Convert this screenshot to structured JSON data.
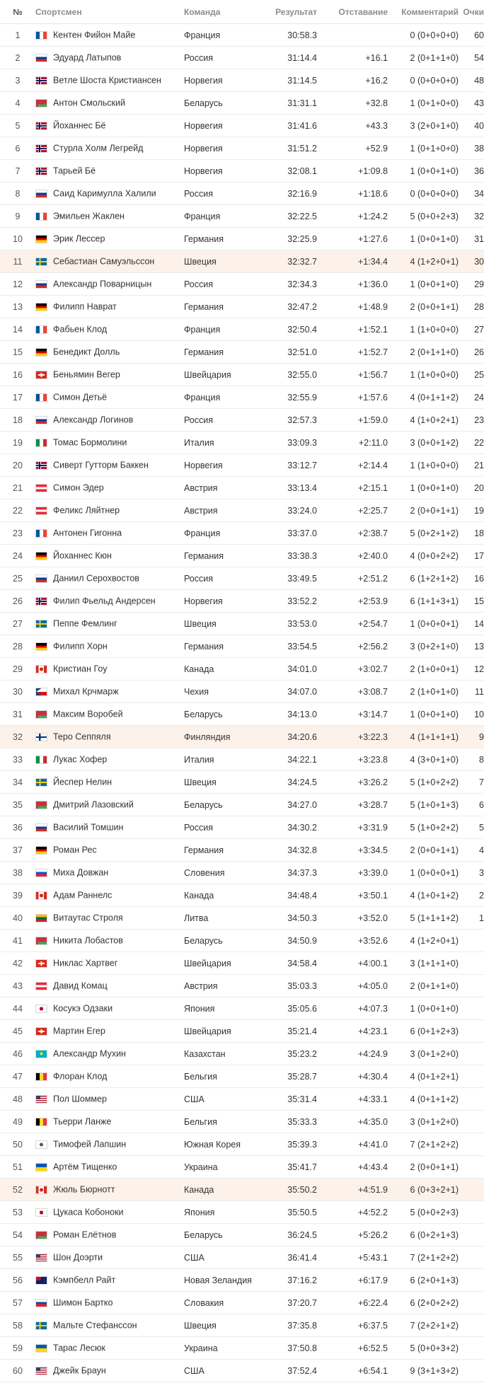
{
  "headers": {
    "num": "№",
    "athlete": "Спортсмен",
    "team": "Команда",
    "result": "Результат",
    "gap": "Отставание",
    "comment": "Комментарий",
    "points": "Очки"
  },
  "highlight_color": "#fdf2ea",
  "rows": [
    {
      "num": "1",
      "flag": "FR",
      "name": "Кентен Фийон Майе",
      "team": "Франция",
      "result": "30:58.3",
      "gap": "",
      "comment": "0 (0+0+0+0)",
      "points": "60"
    },
    {
      "num": "2",
      "flag": "RU",
      "name": "Эдуард Латыпов",
      "team": "Россия",
      "result": "31:14.4",
      "gap": "+16.1",
      "comment": "2 (0+1+1+0)",
      "points": "54"
    },
    {
      "num": "3",
      "flag": "NO",
      "name": "Ветле Шоста Кристиансен",
      "team": "Норвегия",
      "result": "31:14.5",
      "gap": "+16.2",
      "comment": "0 (0+0+0+0)",
      "points": "48"
    },
    {
      "num": "4",
      "flag": "BY",
      "name": "Антон Смольский",
      "team": "Беларусь",
      "result": "31:31.1",
      "gap": "+32.8",
      "comment": "1 (0+1+0+0)",
      "points": "43"
    },
    {
      "num": "5",
      "flag": "NO",
      "name": "Йоханнес Бё",
      "team": "Норвегия",
      "result": "31:41.6",
      "gap": "+43.3",
      "comment": "3 (2+0+1+0)",
      "points": "40"
    },
    {
      "num": "6",
      "flag": "NO",
      "name": "Стурла Холм Легрейд",
      "team": "Норвегия",
      "result": "31:51.2",
      "gap": "+52.9",
      "comment": "1 (0+1+0+0)",
      "points": "38"
    },
    {
      "num": "7",
      "flag": "NO",
      "name": "Тарьей Бё",
      "team": "Норвегия",
      "result": "32:08.1",
      "gap": "+1:09.8",
      "comment": "1 (0+0+1+0)",
      "points": "36"
    },
    {
      "num": "8",
      "flag": "RU",
      "name": "Саид Каримулла Халили",
      "team": "Россия",
      "result": "32:16.9",
      "gap": "+1:18.6",
      "comment": "0 (0+0+0+0)",
      "points": "34"
    },
    {
      "num": "9",
      "flag": "FR",
      "name": "Эмильен Жаклен",
      "team": "Франция",
      "result": "32:22.5",
      "gap": "+1:24.2",
      "comment": "5 (0+0+2+3)",
      "points": "32"
    },
    {
      "num": "10",
      "flag": "DE",
      "name": "Эрик Лессер",
      "team": "Германия",
      "result": "32:25.9",
      "gap": "+1:27.6",
      "comment": "1 (0+0+1+0)",
      "points": "31"
    },
    {
      "num": "11",
      "flag": "SE",
      "name": "Себастиан Самуэльссон",
      "team": "Швеция",
      "result": "32:32.7",
      "gap": "+1:34.4",
      "comment": "4 (1+2+0+1)",
      "points": "30",
      "hl": true
    },
    {
      "num": "12",
      "flag": "RU",
      "name": "Александр Поварницын",
      "team": "Россия",
      "result": "32:34.3",
      "gap": "+1:36.0",
      "comment": "1 (0+0+1+0)",
      "points": "29"
    },
    {
      "num": "13",
      "flag": "DE",
      "name": "Филипп Наврат",
      "team": "Германия",
      "result": "32:47.2",
      "gap": "+1:48.9",
      "comment": "2 (0+0+1+1)",
      "points": "28"
    },
    {
      "num": "14",
      "flag": "FR",
      "name": "Фабьен Клод",
      "team": "Франция",
      "result": "32:50.4",
      "gap": "+1:52.1",
      "comment": "1 (1+0+0+0)",
      "points": "27"
    },
    {
      "num": "15",
      "flag": "DE",
      "name": "Бенедикт Долль",
      "team": "Германия",
      "result": "32:51.0",
      "gap": "+1:52.7",
      "comment": "2 (0+1+1+0)",
      "points": "26"
    },
    {
      "num": "16",
      "flag": "CH",
      "name": "Беньямин Вегер",
      "team": "Швейцария",
      "result": "32:55.0",
      "gap": "+1:56.7",
      "comment": "1 (1+0+0+0)",
      "points": "25"
    },
    {
      "num": "17",
      "flag": "FR",
      "name": "Симон Детьё",
      "team": "Франция",
      "result": "32:55.9",
      "gap": "+1:57.6",
      "comment": "4 (0+1+1+2)",
      "points": "24"
    },
    {
      "num": "18",
      "flag": "RU",
      "name": "Александр Логинов",
      "team": "Россия",
      "result": "32:57.3",
      "gap": "+1:59.0",
      "comment": "4 (1+0+2+1)",
      "points": "23"
    },
    {
      "num": "19",
      "flag": "IT",
      "name": "Томас Бормолини",
      "team": "Италия",
      "result": "33:09.3",
      "gap": "+2:11.0",
      "comment": "3 (0+0+1+2)",
      "points": "22"
    },
    {
      "num": "20",
      "flag": "NO",
      "name": "Сиверт Гутторм Баккен",
      "team": "Норвегия",
      "result": "33:12.7",
      "gap": "+2:14.4",
      "comment": "1 (1+0+0+0)",
      "points": "21"
    },
    {
      "num": "21",
      "flag": "AT",
      "name": "Симон Эдер",
      "team": "Австрия",
      "result": "33:13.4",
      "gap": "+2:15.1",
      "comment": "1 (0+0+1+0)",
      "points": "20"
    },
    {
      "num": "22",
      "flag": "AT",
      "name": "Феликс Ляйтнер",
      "team": "Австрия",
      "result": "33:24.0",
      "gap": "+2:25.7",
      "comment": "2 (0+0+1+1)",
      "points": "19"
    },
    {
      "num": "23",
      "flag": "FR",
      "name": "Антонен Гигонна",
      "team": "Франция",
      "result": "33:37.0",
      "gap": "+2:38.7",
      "comment": "5 (0+2+1+2)",
      "points": "18"
    },
    {
      "num": "24",
      "flag": "DE",
      "name": "Йоханнес Кюн",
      "team": "Германия",
      "result": "33:38.3",
      "gap": "+2:40.0",
      "comment": "4 (0+0+2+2)",
      "points": "17"
    },
    {
      "num": "25",
      "flag": "RU",
      "name": "Даниил Серохвостов",
      "team": "Россия",
      "result": "33:49.5",
      "gap": "+2:51.2",
      "comment": "6 (1+2+1+2)",
      "points": "16"
    },
    {
      "num": "26",
      "flag": "NO",
      "name": "Филип Фьельд Андерсен",
      "team": "Норвегия",
      "result": "33:52.2",
      "gap": "+2:53.9",
      "comment": "6 (1+1+3+1)",
      "points": "15"
    },
    {
      "num": "27",
      "flag": "SE",
      "name": "Пеппе Фемлинг",
      "team": "Швеция",
      "result": "33:53.0",
      "gap": "+2:54.7",
      "comment": "1 (0+0+0+1)",
      "points": "14"
    },
    {
      "num": "28",
      "flag": "DE",
      "name": "Филипп Хорн",
      "team": "Германия",
      "result": "33:54.5",
      "gap": "+2:56.2",
      "comment": "3 (0+2+1+0)",
      "points": "13"
    },
    {
      "num": "29",
      "flag": "CA",
      "name": "Кристиан Гоу",
      "team": "Канада",
      "result": "34:01.0",
      "gap": "+3:02.7",
      "comment": "2 (1+0+0+1)",
      "points": "12"
    },
    {
      "num": "30",
      "flag": "CZ",
      "name": "Михал Крчмарж",
      "team": "Чехия",
      "result": "34:07.0",
      "gap": "+3:08.7",
      "comment": "2 (1+0+1+0)",
      "points": "11"
    },
    {
      "num": "31",
      "flag": "BY",
      "name": "Максим Воробей",
      "team": "Беларусь",
      "result": "34:13.0",
      "gap": "+3:14.7",
      "comment": "1 (0+0+1+0)",
      "points": "10"
    },
    {
      "num": "32",
      "flag": "FI",
      "name": "Теро Сеппяля",
      "team": "Финляндия",
      "result": "34:20.6",
      "gap": "+3:22.3",
      "comment": "4 (1+1+1+1)",
      "points": "9",
      "hl": true
    },
    {
      "num": "33",
      "flag": "IT",
      "name": "Лукас Хофер",
      "team": "Италия",
      "result": "34:22.1",
      "gap": "+3:23.8",
      "comment": "4 (3+0+1+0)",
      "points": "8"
    },
    {
      "num": "34",
      "flag": "SE",
      "name": "Йеспер Нелин",
      "team": "Швеция",
      "result": "34:24.5",
      "gap": "+3:26.2",
      "comment": "5 (1+0+2+2)",
      "points": "7"
    },
    {
      "num": "35",
      "flag": "BY",
      "name": "Дмитрий Лазовский",
      "team": "Беларусь",
      "result": "34:27.0",
      "gap": "+3:28.7",
      "comment": "5 (1+0+1+3)",
      "points": "6"
    },
    {
      "num": "36",
      "flag": "RU",
      "name": "Василий Томшин",
      "team": "Россия",
      "result": "34:30.2",
      "gap": "+3:31.9",
      "comment": "5 (1+0+2+2)",
      "points": "5"
    },
    {
      "num": "37",
      "flag": "DE",
      "name": "Роман Рес",
      "team": "Германия",
      "result": "34:32.8",
      "gap": "+3:34.5",
      "comment": "2 (0+0+1+1)",
      "points": "4"
    },
    {
      "num": "38",
      "flag": "SI",
      "name": "Миха Довжан",
      "team": "Словения",
      "result": "34:37.3",
      "gap": "+3:39.0",
      "comment": "1 (0+0+0+1)",
      "points": "3"
    },
    {
      "num": "39",
      "flag": "CA",
      "name": "Адам Раннелс",
      "team": "Канада",
      "result": "34:48.4",
      "gap": "+3:50.1",
      "comment": "4 (1+0+1+2)",
      "points": "2"
    },
    {
      "num": "40",
      "flag": "LT",
      "name": "Витаутас Строля",
      "team": "Литва",
      "result": "34:50.3",
      "gap": "+3:52.0",
      "comment": "5 (1+1+1+2)",
      "points": "1"
    },
    {
      "num": "41",
      "flag": "BY",
      "name": "Никита Лобастов",
      "team": "Беларусь",
      "result": "34:50.9",
      "gap": "+3:52.6",
      "comment": "4 (1+2+0+1)",
      "points": ""
    },
    {
      "num": "42",
      "flag": "CH",
      "name": "Никлас Хартвег",
      "team": "Швейцария",
      "result": "34:58.4",
      "gap": "+4:00.1",
      "comment": "3 (1+1+1+0)",
      "points": ""
    },
    {
      "num": "43",
      "flag": "AT",
      "name": "Давид Комац",
      "team": "Австрия",
      "result": "35:03.3",
      "gap": "+4:05.0",
      "comment": "2 (0+1+1+0)",
      "points": ""
    },
    {
      "num": "44",
      "flag": "JP",
      "name": "Косукэ Одзаки",
      "team": "Япония",
      "result": "35:05.6",
      "gap": "+4:07.3",
      "comment": "1 (0+0+1+0)",
      "points": ""
    },
    {
      "num": "45",
      "flag": "CH",
      "name": "Мартин Егер",
      "team": "Швейцария",
      "result": "35:21.4",
      "gap": "+4:23.1",
      "comment": "6 (0+1+2+3)",
      "points": ""
    },
    {
      "num": "46",
      "flag": "KZ",
      "name": "Александр Мухин",
      "team": "Казахстан",
      "result": "35:23.2",
      "gap": "+4:24.9",
      "comment": "3 (0+1+2+0)",
      "points": ""
    },
    {
      "num": "47",
      "flag": "BE",
      "name": "Флоран Клод",
      "team": "Бельгия",
      "result": "35:28.7",
      "gap": "+4:30.4",
      "comment": "4 (0+1+2+1)",
      "points": ""
    },
    {
      "num": "48",
      "flag": "US",
      "name": "Пол Шоммер",
      "team": "США",
      "result": "35:31.4",
      "gap": "+4:33.1",
      "comment": "4 (0+1+1+2)",
      "points": ""
    },
    {
      "num": "49",
      "flag": "BE",
      "name": "Тьерри Ланже",
      "team": "Бельгия",
      "result": "35:33.3",
      "gap": "+4:35.0",
      "comment": "3 (0+1+2+0)",
      "points": ""
    },
    {
      "num": "50",
      "flag": "KR",
      "name": "Тимофей Лапшин",
      "team": "Южная Корея",
      "result": "35:39.3",
      "gap": "+4:41.0",
      "comment": "7 (2+1+2+2)",
      "points": ""
    },
    {
      "num": "51",
      "flag": "UA",
      "name": "Артём Тищенко",
      "team": "Украина",
      "result": "35:41.7",
      "gap": "+4:43.4",
      "comment": "2 (0+0+1+1)",
      "points": ""
    },
    {
      "num": "52",
      "flag": "CA",
      "name": "Жюль Бюрнотт",
      "team": "Канада",
      "result": "35:50.2",
      "gap": "+4:51.9",
      "comment": "6 (0+3+2+1)",
      "points": "",
      "hl": true
    },
    {
      "num": "53",
      "flag": "JP",
      "name": "Цукаса Кобоноки",
      "team": "Япония",
      "result": "35:50.5",
      "gap": "+4:52.2",
      "comment": "5 (0+0+2+3)",
      "points": ""
    },
    {
      "num": "54",
      "flag": "BY",
      "name": "Роман Елётнов",
      "team": "Беларусь",
      "result": "36:24.5",
      "gap": "+5:26.2",
      "comment": "6 (0+2+1+3)",
      "points": ""
    },
    {
      "num": "55",
      "flag": "US",
      "name": "Шон Доэрти",
      "team": "США",
      "result": "36:41.4",
      "gap": "+5:43.1",
      "comment": "7 (2+1+2+2)",
      "points": ""
    },
    {
      "num": "56",
      "flag": "NZ",
      "name": "Кэмпбелл Райт",
      "team": "Новая Зеландия",
      "result": "37:16.2",
      "gap": "+6:17.9",
      "comment": "6 (2+0+1+3)",
      "points": ""
    },
    {
      "num": "57",
      "flag": "SK",
      "name": "Шимон Бартко",
      "team": "Словакия",
      "result": "37:20.7",
      "gap": "+6:22.4",
      "comment": "6 (2+0+2+2)",
      "points": ""
    },
    {
      "num": "58",
      "flag": "SE",
      "name": "Мальте Стефанссон",
      "team": "Швеция",
      "result": "37:35.8",
      "gap": "+6:37.5",
      "comment": "7 (2+2+1+2)",
      "points": ""
    },
    {
      "num": "59",
      "flag": "UA",
      "name": "Тарас Лесюк",
      "team": "Украина",
      "result": "37:50.8",
      "gap": "+6:52.5",
      "comment": "5 (0+0+3+2)",
      "points": ""
    },
    {
      "num": "60",
      "flag": "US",
      "name": "Джейк Браун",
      "team": "США",
      "result": "37:52.4",
      "gap": "+6:54.1",
      "comment": "9 (3+1+3+2)",
      "points": ""
    }
  ]
}
